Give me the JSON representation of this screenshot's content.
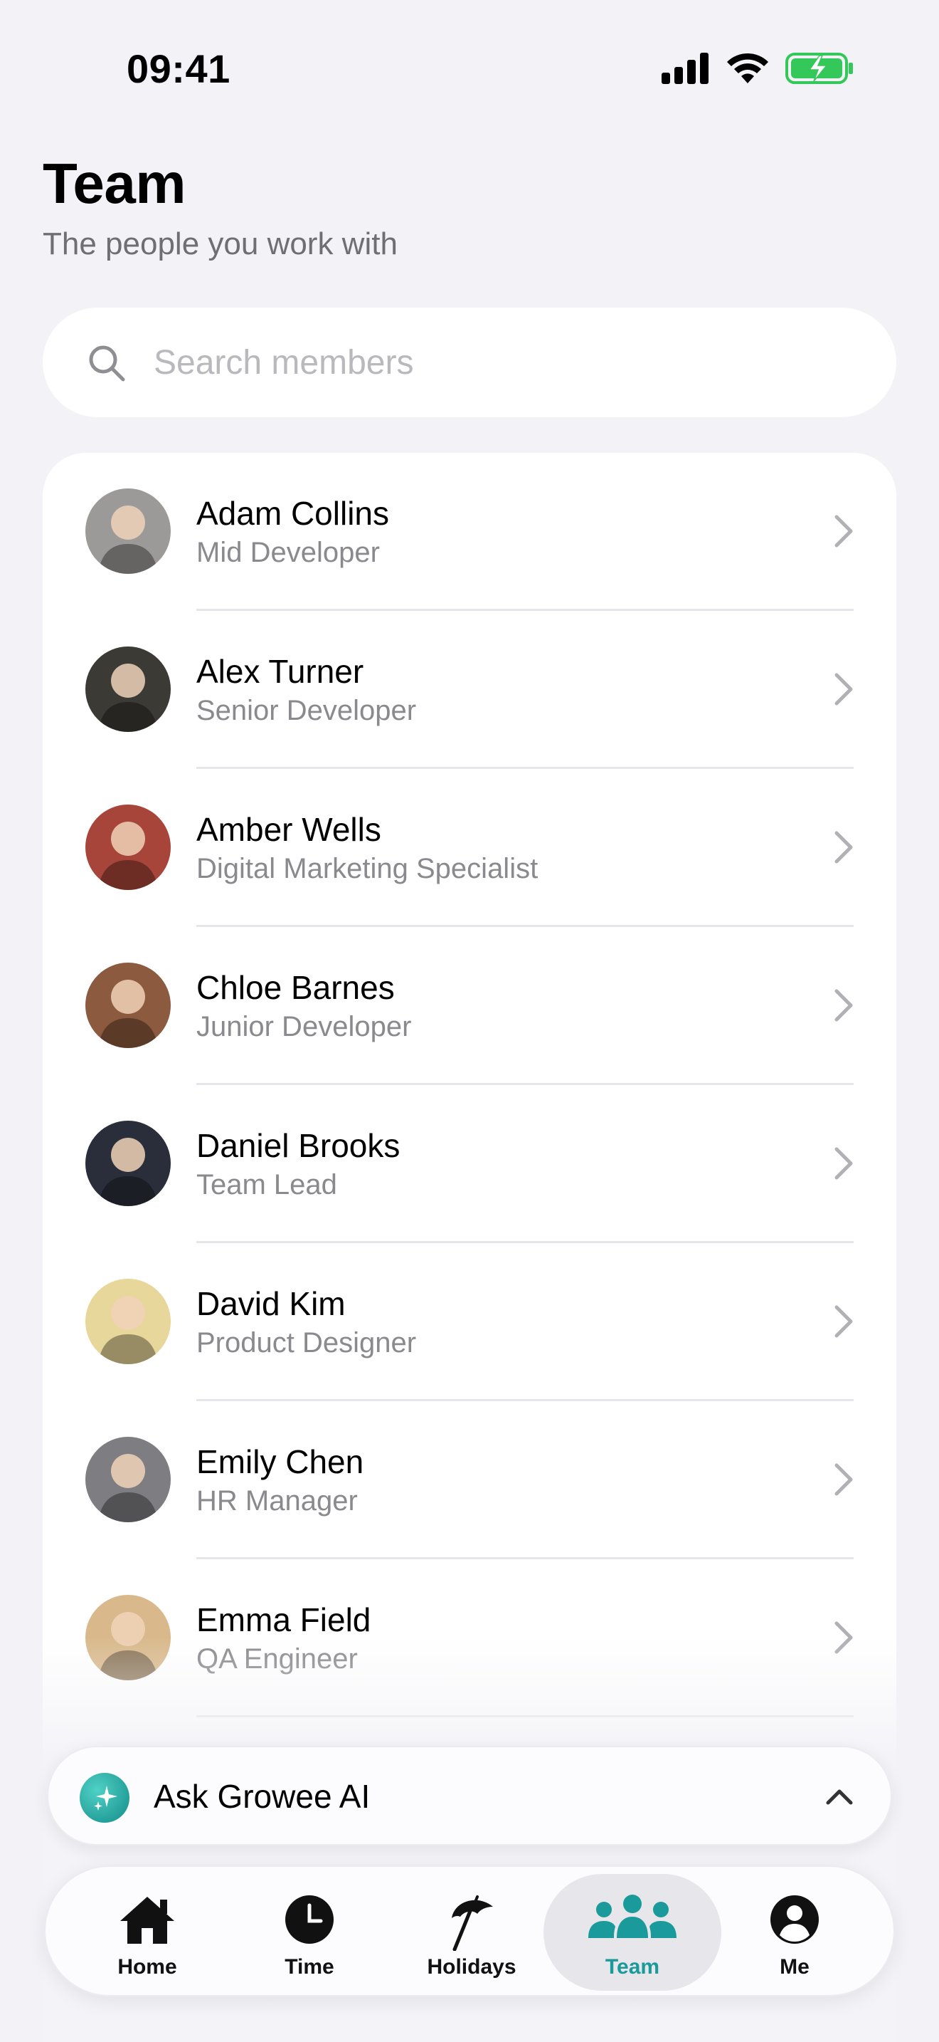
{
  "status_bar": {
    "time": "09:41"
  },
  "header": {
    "title": "Team",
    "subtitle": "The people you work with"
  },
  "search": {
    "placeholder": "Search members",
    "value": ""
  },
  "members": [
    {
      "name": "Adam Collins",
      "role": "Mid Developer",
      "avatar_color": "#9C9A98"
    },
    {
      "name": "Alex Turner",
      "role": "Senior Developer",
      "avatar_color": "#3B3A35"
    },
    {
      "name": "Amber Wells",
      "role": "Digital Marketing Specialist",
      "avatar_color": "#A8453A"
    },
    {
      "name": "Chloe Barnes",
      "role": "Junior Developer",
      "avatar_color": "#8C5A3E"
    },
    {
      "name": "Daniel Brooks",
      "role": "Team Lead",
      "avatar_color": "#2A2E3A"
    },
    {
      "name": "David Kim",
      "role": "Product Designer",
      "avatar_color": "#E8D79A"
    },
    {
      "name": "Emily Chen",
      "role": "HR Manager",
      "avatar_color": "#7E7E82"
    },
    {
      "name": "Emma Field",
      "role": "QA Engineer",
      "avatar_color": "#D9B98C"
    }
  ],
  "ai_bar": {
    "label": "Ask Growee AI"
  },
  "tabs": [
    {
      "label": "Home",
      "icon": "house-icon",
      "active": false
    },
    {
      "label": "Time",
      "icon": "clock-icon",
      "active": false
    },
    {
      "label": "Holidays",
      "icon": "beach-umbrella-icon",
      "active": false
    },
    {
      "label": "Team",
      "icon": "people-icon",
      "active": true
    },
    {
      "label": "Me",
      "icon": "person-circle-icon",
      "active": false
    }
  ],
  "colors": {
    "accent": "#1A9A9A",
    "background": "#F2F2F7",
    "battery": "#34C759"
  }
}
